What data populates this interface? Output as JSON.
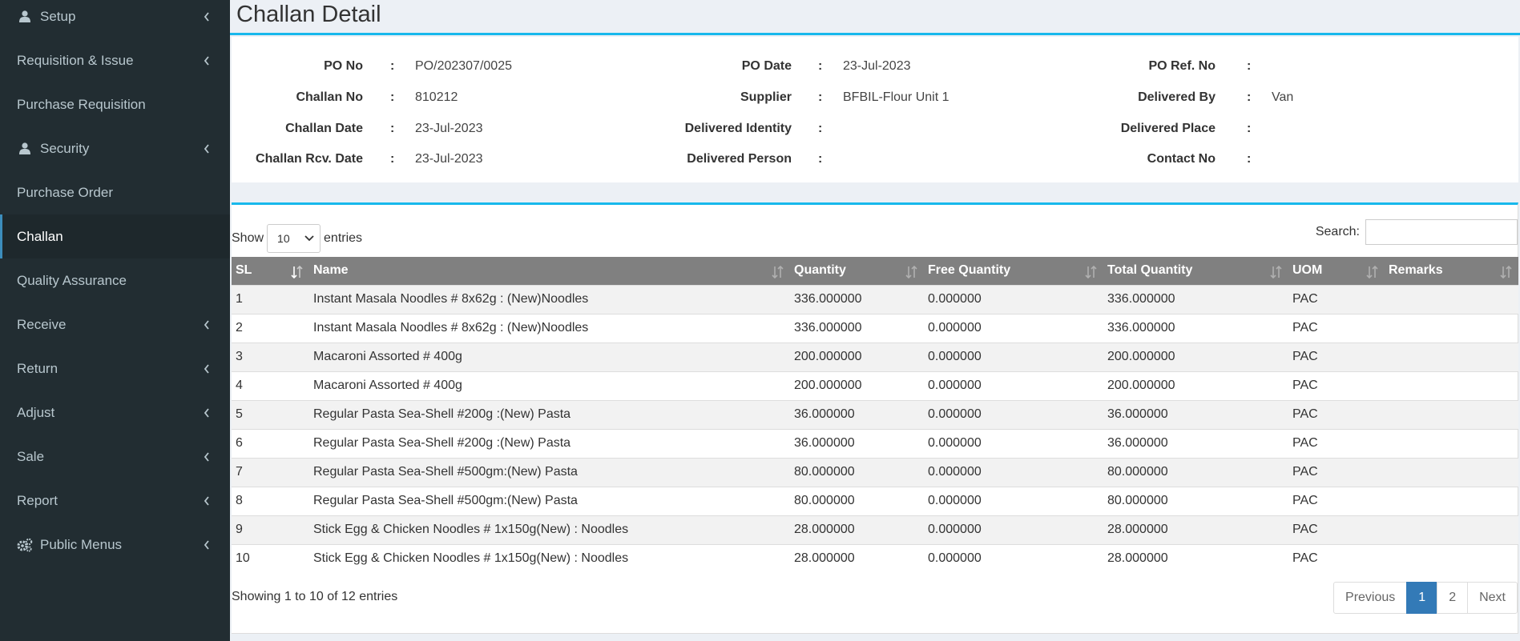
{
  "sidebar": {
    "items": [
      {
        "label": "Setup",
        "icon": "user-icon",
        "chevron": true
      },
      {
        "label": "Requisition & Issue",
        "icon": "",
        "chevron": true
      },
      {
        "label": "Purchase Requisition",
        "icon": "",
        "chevron": false
      },
      {
        "label": "Security",
        "icon": "user-icon",
        "chevron": true
      },
      {
        "label": "Purchase Order",
        "icon": "",
        "chevron": false
      },
      {
        "label": "Challan",
        "icon": "",
        "chevron": false,
        "active": true
      },
      {
        "label": "Quality Assurance",
        "icon": "",
        "chevron": false
      },
      {
        "label": "Receive",
        "icon": "",
        "chevron": true
      },
      {
        "label": "Return",
        "icon": "",
        "chevron": true
      },
      {
        "label": "Adjust",
        "icon": "",
        "chevron": true
      },
      {
        "label": "Sale",
        "icon": "",
        "chevron": true
      },
      {
        "label": "Report",
        "icon": "",
        "chevron": true
      },
      {
        "label": "Public Menus",
        "icon": "gears-icon",
        "chevron": true
      }
    ]
  },
  "page": {
    "title": "Challan Detail"
  },
  "details": {
    "po_no": {
      "label": "PO No",
      "value": "PO/202307/0025"
    },
    "po_date": {
      "label": "PO Date",
      "value": "23-Jul-2023"
    },
    "po_ref_no": {
      "label": "PO Ref. No",
      "value": ""
    },
    "challan_no": {
      "label": "Challan No",
      "value": "810212"
    },
    "supplier": {
      "label": "Supplier",
      "value": "BFBIL-Flour Unit 1"
    },
    "delivered_by": {
      "label": "Delivered By",
      "value": "Van"
    },
    "challan_date": {
      "label": "Challan Date",
      "value": "23-Jul-2023"
    },
    "delivered_identity": {
      "label": "Delivered Identity",
      "value": ""
    },
    "delivered_place": {
      "label": "Delivered Place",
      "value": ""
    },
    "challan_rcv_date": {
      "label": "Challan Rcv. Date",
      "value": "23-Jul-2023"
    },
    "delivered_person": {
      "label": "Delivered Person",
      "value": ""
    },
    "contact_no": {
      "label": "Contact No",
      "value": ""
    },
    "separator": ":"
  },
  "table_controls": {
    "show_label": "Show",
    "entries_label": "entries",
    "page_length": "10",
    "search_label": "Search:",
    "search_value": ""
  },
  "table": {
    "columns": [
      "SL",
      "Name",
      "Quantity",
      "Free Quantity",
      "Total Quantity",
      "UOM",
      "Remarks"
    ],
    "rows": [
      [
        "1",
        "Instant Masala Noodles # 8x62g : (New)Noodles",
        "336.000000",
        "0.000000",
        "336.000000",
        "PAC",
        ""
      ],
      [
        "2",
        "Instant Masala Noodles # 8x62g : (New)Noodles",
        "336.000000",
        "0.000000",
        "336.000000",
        "PAC",
        ""
      ],
      [
        "3",
        "Macaroni Assorted # 400g",
        "200.000000",
        "0.000000",
        "200.000000",
        "PAC",
        ""
      ],
      [
        "4",
        "Macaroni Assorted # 400g",
        "200.000000",
        "0.000000",
        "200.000000",
        "PAC",
        ""
      ],
      [
        "5",
        "Regular Pasta Sea-Shell #200g :(New) Pasta",
        "36.000000",
        "0.000000",
        "36.000000",
        "PAC",
        ""
      ],
      [
        "6",
        "Regular Pasta Sea-Shell #200g :(New) Pasta",
        "36.000000",
        "0.000000",
        "36.000000",
        "PAC",
        ""
      ],
      [
        "7",
        "Regular Pasta Sea-Shell #500gm:(New) Pasta",
        "80.000000",
        "0.000000",
        "80.000000",
        "PAC",
        ""
      ],
      [
        "8",
        "Regular Pasta Sea-Shell #500gm:(New) Pasta",
        "80.000000",
        "0.000000",
        "80.000000",
        "PAC",
        ""
      ],
      [
        "9",
        "Stick Egg & Chicken Noodles # 1x150g(New) : Noodles",
        "28.000000",
        "0.000000",
        "28.000000",
        "PAC",
        ""
      ],
      [
        "10",
        "Stick Egg & Chicken Noodles # 1x150g(New) : Noodles",
        "28.000000",
        "0.000000",
        "28.000000",
        "PAC",
        ""
      ]
    ]
  },
  "footer": {
    "info": "Showing 1 to 10 of 12 entries",
    "pagination": {
      "previous": "Previous",
      "pages": [
        "1",
        "2"
      ],
      "current": "1",
      "next": "Next"
    }
  },
  "colors": {
    "sidebar_bg": "#222d32",
    "accent": "#18b8ec",
    "header_bg": "#808080",
    "active_page": "#337ab7"
  }
}
